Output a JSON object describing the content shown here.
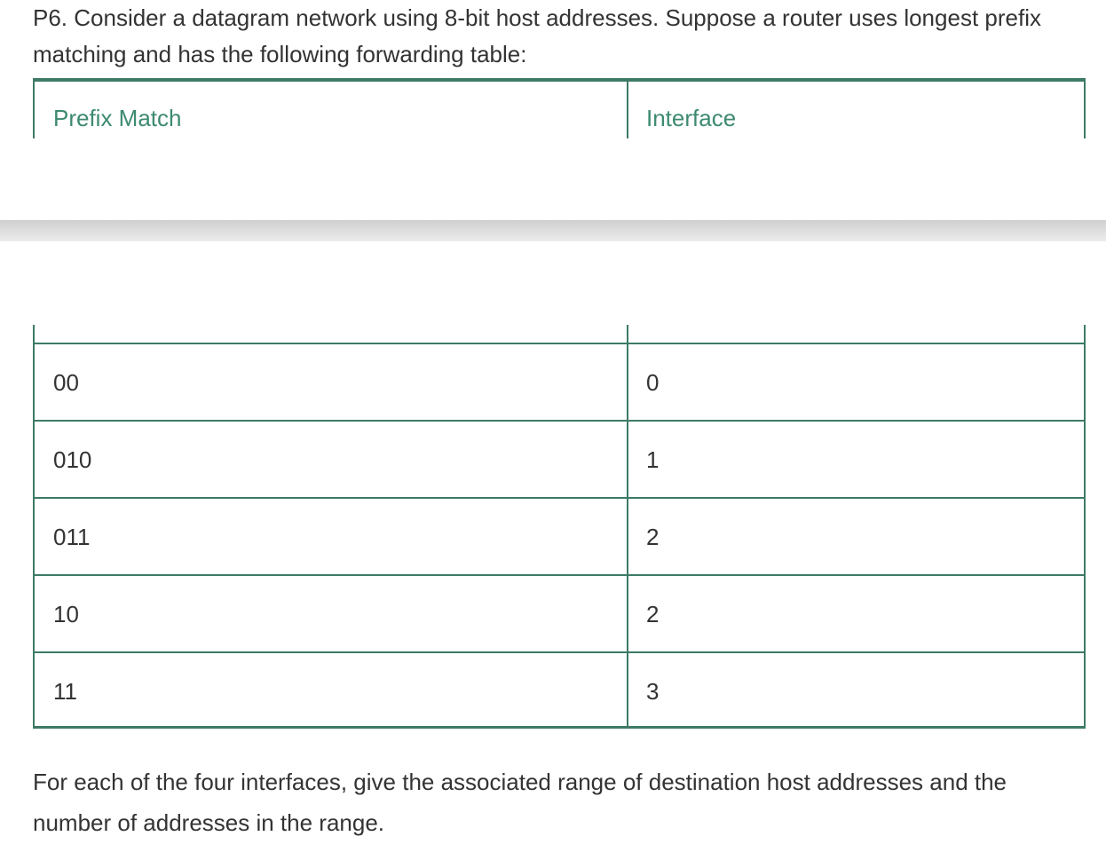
{
  "problem": {
    "intro_text": "P6. Consider a datagram network using 8-bit host addresses. Suppose a router uses longest prefix matching and has the following forwarding table:",
    "outro_text": "For each of the four interfaces, give the associated range of destination host addresses and the number of addresses in the range."
  },
  "table": {
    "headers": [
      "Prefix Match",
      "Interface"
    ],
    "rows": [
      {
        "prefix": "00",
        "interface": "0"
      },
      {
        "prefix": "010",
        "interface": "1"
      },
      {
        "prefix": "011",
        "interface": "2"
      },
      {
        "prefix": "10",
        "interface": "2"
      },
      {
        "prefix": "11",
        "interface": "3"
      }
    ]
  },
  "colors": {
    "accent": "#3d7b66",
    "header_text": "#3d8a70",
    "body_text": "#333333"
  }
}
